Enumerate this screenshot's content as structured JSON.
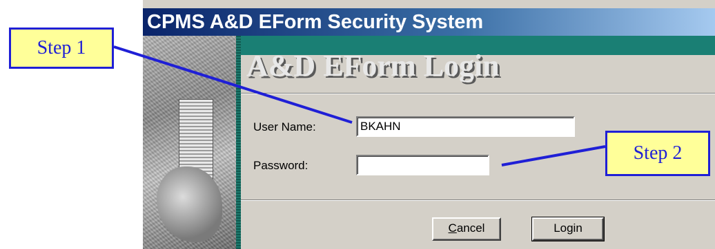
{
  "window": {
    "title": "CPMS A&D EForm Security System",
    "heading": "A&D EForm Login"
  },
  "form": {
    "username_label": "User Name:",
    "username_value": "BKAHN",
    "password_label": "Password:",
    "password_value": ""
  },
  "buttons": {
    "cancel_accel": "C",
    "cancel_rest": "ancel",
    "login_label": "Login"
  },
  "callouts": {
    "step1": "Step 1",
    "step2": "Step 2"
  },
  "colors": {
    "titlebar_start": "#0a246a",
    "teal_band": "#1a7f74",
    "callout_fill": "#ffff99",
    "callout_border": "#1f1fd6",
    "dialog_face": "#d4d0c8"
  }
}
